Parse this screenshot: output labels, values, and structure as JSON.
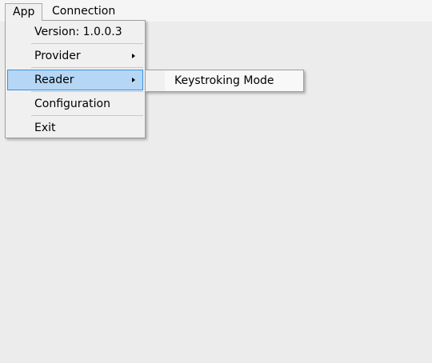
{
  "menubar": {
    "items": [
      {
        "label": "App"
      },
      {
        "label": "Connection"
      }
    ]
  },
  "app_menu": {
    "items": [
      {
        "label": "Version: 1.0.0.3"
      },
      {
        "label": "Provider"
      },
      {
        "label": "Reader"
      },
      {
        "label": "Configuration"
      },
      {
        "label": "Exit"
      }
    ]
  },
  "reader_submenu": {
    "items": [
      {
        "label": "Keystroking Mode"
      }
    ]
  },
  "colors": {
    "background": "#ececec",
    "menu_highlight": "#b5d7f5",
    "menu_highlight_border": "#3b8ee6"
  }
}
